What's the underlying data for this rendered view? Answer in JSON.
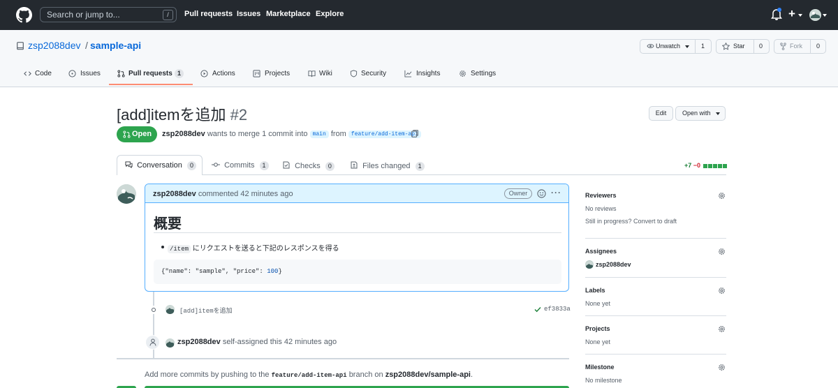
{
  "header": {
    "search_placeholder": "Search or jump to...",
    "search_shortcut": "/",
    "nav": [
      "Pull requests",
      "Issues",
      "Marketplace",
      "Explore"
    ],
    "plus_label": "+"
  },
  "repo": {
    "owner": "zsp2088dev",
    "separator": "/",
    "name": "sample-api",
    "watch_label": "Unwatch",
    "watch_count": "1",
    "star_label": "Star",
    "star_count": "0",
    "fork_label": "Fork",
    "fork_count": "0",
    "tabs": [
      {
        "label": "Code",
        "icon": "code-icon"
      },
      {
        "label": "Issues",
        "icon": "issue-icon"
      },
      {
        "label": "Pull requests",
        "icon": "pull-request-icon",
        "count": "1"
      },
      {
        "label": "Actions",
        "icon": "play-icon"
      },
      {
        "label": "Projects",
        "icon": "project-icon"
      },
      {
        "label": "Wiki",
        "icon": "book-icon"
      },
      {
        "label": "Security",
        "icon": "shield-icon"
      },
      {
        "label": "Insights",
        "icon": "graph-icon"
      },
      {
        "label": "Settings",
        "icon": "gear-icon"
      }
    ]
  },
  "pr": {
    "title": "[add]itemを追加",
    "number": "#2",
    "edit_label": "Edit",
    "open_with_label": "Open with",
    "state": "Open",
    "author": "zsp2088dev",
    "merge_text": "wants to merge 1 commit into",
    "base_branch": "main",
    "from_text": "from",
    "head_branch": "feature/add-item-api",
    "tabs": [
      {
        "label": "Conversation",
        "count": "0"
      },
      {
        "label": "Commits",
        "count": "1"
      },
      {
        "label": "Checks",
        "count": "0"
      },
      {
        "label": "Files changed",
        "count": "1"
      }
    ],
    "additions": "+7",
    "deletions": "−0"
  },
  "comment": {
    "author": "zsp2088dev",
    "action": "commented 42 minutes ago",
    "role": "Owner",
    "heading": "概要",
    "list_code": "/item",
    "list_text": "にリクエストを送ると下記のレスポンスを得る",
    "code_prefix": "{\"name\": \"sample\", \"price\": ",
    "code_number": "100",
    "code_suffix": "}"
  },
  "timeline": {
    "commit_message": "[add]itemを追加",
    "commit_sha": "ef3833a",
    "assign_user": "zsp2088dev",
    "assign_text": "self-assigned this 42 minutes ago",
    "push_prefix": "Add more commits by pushing to the",
    "push_branch": "feature/add-item-api",
    "push_middle": "branch on",
    "push_repo": "zsp2088dev/sample-api",
    "push_suffix": "."
  },
  "sidebar": {
    "reviewers_title": "Reviewers",
    "reviewers_value": "No reviews",
    "draft_text": "Still in progress? Convert to draft",
    "assignees_title": "Assignees",
    "assignee": "zsp2088dev",
    "labels_title": "Labels",
    "labels_value": "None yet",
    "projects_title": "Projects",
    "projects_value": "None yet",
    "milestone_title": "Milestone",
    "milestone_value": "No milestone"
  },
  "colors": {
    "header_bg": "#24292f",
    "link": "#0969da",
    "open_green": "#2da44e",
    "tab_accent": "#fd8c73",
    "comment_border": "#54aeff",
    "comment_header": "#ddf4ff"
  }
}
